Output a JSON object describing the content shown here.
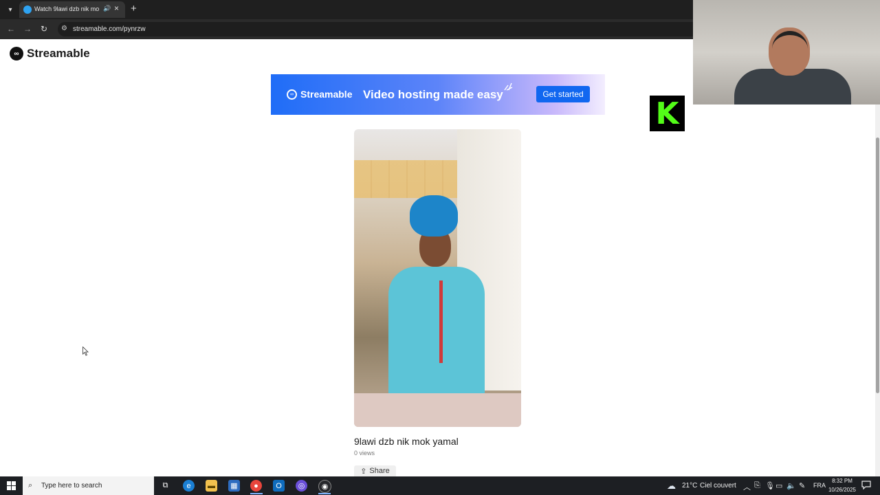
{
  "browser": {
    "tab_title": "Watch 9lawi dzb nik mok yamal",
    "url": "streamable.com/pynrzw"
  },
  "page": {
    "logo_text": "Streamable",
    "banner": {
      "brand": "Streamable",
      "tagline": "Video hosting made easy",
      "cta": "Get started"
    },
    "video": {
      "title": "9lawi dzb nik mok yamal",
      "views": "0 views",
      "share_label": "Share"
    }
  },
  "overlay": {
    "kick_letter": "K"
  },
  "taskbar": {
    "search_placeholder": "Type here to search",
    "weather_temp": "21°C",
    "weather_desc": "Ciel couvert",
    "language": "FRA",
    "time": "8:32 PM",
    "date": "10/26/2025"
  },
  "colors": {
    "accent": "#1167f0",
    "kick_green": "#53fc18"
  }
}
